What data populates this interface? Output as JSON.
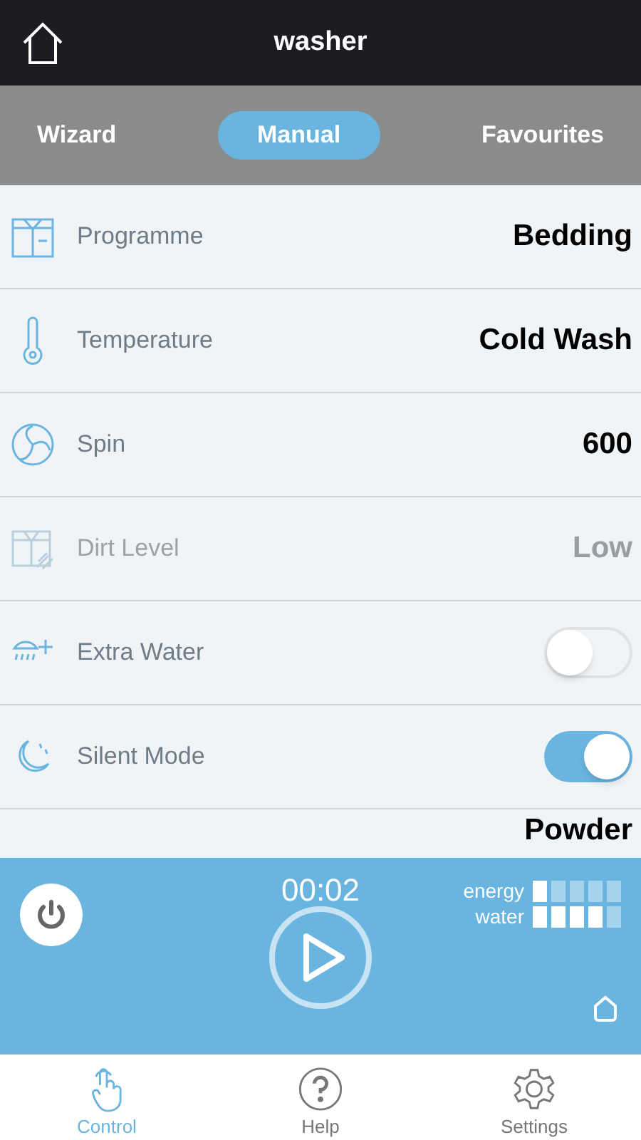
{
  "header": {
    "title": "washer"
  },
  "tabs": [
    {
      "label": "Wizard",
      "selected": false
    },
    {
      "label": "Manual",
      "selected": true
    },
    {
      "label": "Favourites",
      "selected": false
    }
  ],
  "settings": [
    {
      "kind": "value",
      "label": "Programme",
      "value": "Bedding",
      "disabled": false
    },
    {
      "kind": "value",
      "label": "Temperature",
      "value": "Cold Wash",
      "disabled": false
    },
    {
      "kind": "value",
      "label": "Spin",
      "value": "600",
      "disabled": false
    },
    {
      "kind": "value",
      "label": "Dirt Level",
      "value": "Low",
      "disabled": true
    },
    {
      "kind": "toggle",
      "label": "Extra Water",
      "on": false
    },
    {
      "kind": "toggle",
      "label": "Silent Mode",
      "on": true
    },
    {
      "kind": "value",
      "value": "Powder",
      "disabled": false
    }
  ],
  "panel": {
    "timer": "00:02",
    "meters": [
      {
        "label": "energy"
      },
      {
        "label": "water"
      }
    ]
  },
  "bottom_tabs": [
    {
      "label": "Control",
      "selected": true
    },
    {
      "label": "Help",
      "selected": false
    },
    {
      "label": "Settings",
      "selected": false
    }
  ]
}
